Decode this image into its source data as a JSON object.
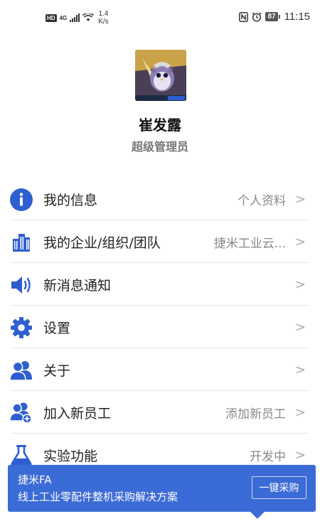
{
  "status_bar": {
    "hd": "HD",
    "network": "4G",
    "speed_value": "1.4",
    "speed_unit": "K/s",
    "battery": "87",
    "time": "11:15"
  },
  "profile": {
    "name": "崔发露",
    "role": "超级管理员"
  },
  "menu": {
    "items": [
      {
        "icon": "info-icon",
        "label": "我的信息",
        "value": "个人资料"
      },
      {
        "icon": "building-icon",
        "label": "我的企业/组织/团队",
        "value": "捷米工业云..."
      },
      {
        "icon": "speaker-icon",
        "label": "新消息通知",
        "value": ""
      },
      {
        "icon": "gear-icon",
        "label": "设置",
        "value": ""
      },
      {
        "icon": "users-icon",
        "label": "关于",
        "value": ""
      },
      {
        "icon": "add-user-icon",
        "label": "加入新员工",
        "value": "添加新员工"
      },
      {
        "icon": "flask-icon",
        "label": "实验功能",
        "value": "开发中"
      }
    ],
    "chevron": ">"
  },
  "banner": {
    "title": "捷米FA",
    "description": "线上工业零配件整机采购解决方案",
    "button": "一键采购"
  },
  "colors": {
    "accent": "#2e5fd0",
    "banner": "#3b6bd6"
  }
}
